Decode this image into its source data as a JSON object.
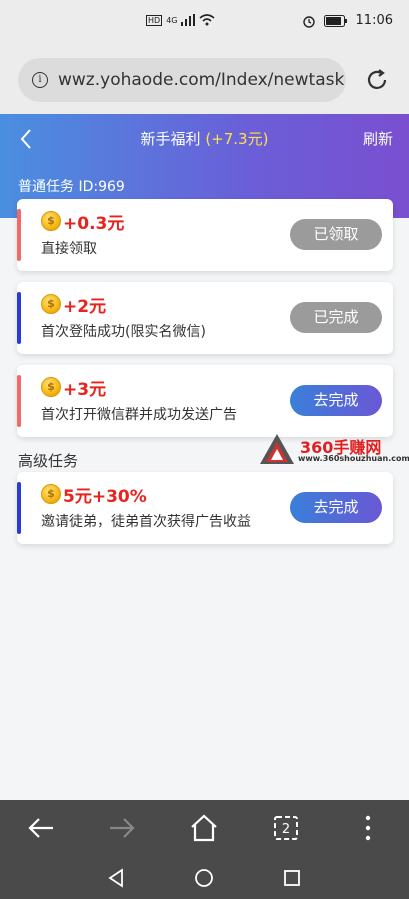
{
  "status_bar": {
    "signal_badge": "HD",
    "network": "4G",
    "time": "11:06"
  },
  "browser": {
    "url": "wwz.yohaode.com/Index/newtask"
  },
  "header": {
    "title": "新手福利",
    "bonus": "(+7.3元)",
    "refresh_label": "刷新"
  },
  "sections": {
    "normal_title": "普通任务 ID:969",
    "advanced_title": "高级任务"
  },
  "tasks": [
    {
      "reward": "+0.3元",
      "desc": "直接领取",
      "button": "已领取",
      "state": "done",
      "stripe_color": "#f06a6a"
    },
    {
      "reward": "+2元",
      "desc": "首次登陆成功(限实名微信)",
      "button": "已完成",
      "state": "done",
      "stripe_color": "#2a3bd8"
    },
    {
      "reward": "+3元",
      "desc": "首次打开微信群并成功发送广告",
      "button": "去完成",
      "state": "go",
      "stripe_color": "#f06a6a"
    },
    {
      "reward": "5元+30%",
      "desc": "邀请徒弟，徒弟首次获得广告收益",
      "button": "去完成",
      "state": "go",
      "stripe_color": "#2a3bd8"
    }
  ],
  "watermark": {
    "brand": "360手赚网",
    "site": "www.360shouzhuan.com"
  },
  "coin_glyph": "$",
  "tab_count": "2",
  "icons": [
    "info-icon",
    "refresh-icon",
    "back-icon",
    "coin-icon",
    "nav-back-icon",
    "nav-forward-icon",
    "home-icon",
    "tabs-icon",
    "more-icon"
  ]
}
